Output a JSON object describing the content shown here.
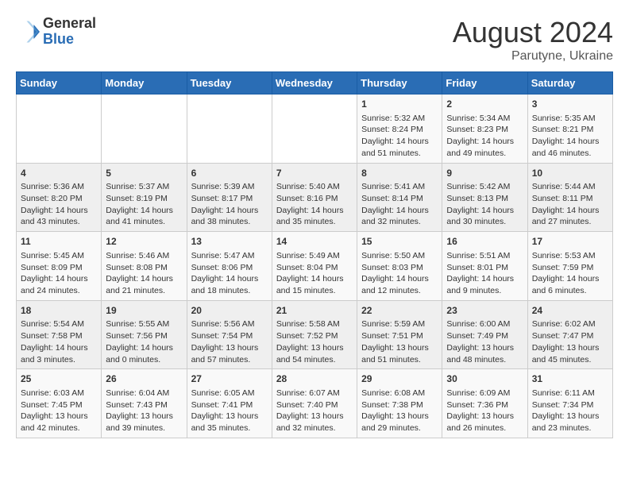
{
  "header": {
    "logo_general": "General",
    "logo_blue": "Blue",
    "month_year": "August 2024",
    "location": "Parutyne, Ukraine"
  },
  "calendar": {
    "days_of_week": [
      "Sunday",
      "Monday",
      "Tuesday",
      "Wednesday",
      "Thursday",
      "Friday",
      "Saturday"
    ],
    "weeks": [
      [
        {
          "day": "",
          "content": ""
        },
        {
          "day": "",
          "content": ""
        },
        {
          "day": "",
          "content": ""
        },
        {
          "day": "",
          "content": ""
        },
        {
          "day": "1",
          "content": "Sunrise: 5:32 AM\nSunset: 8:24 PM\nDaylight: 14 hours and 51 minutes."
        },
        {
          "day": "2",
          "content": "Sunrise: 5:34 AM\nSunset: 8:23 PM\nDaylight: 14 hours and 49 minutes."
        },
        {
          "day": "3",
          "content": "Sunrise: 5:35 AM\nSunset: 8:21 PM\nDaylight: 14 hours and 46 minutes."
        }
      ],
      [
        {
          "day": "4",
          "content": "Sunrise: 5:36 AM\nSunset: 8:20 PM\nDaylight: 14 hours and 43 minutes."
        },
        {
          "day": "5",
          "content": "Sunrise: 5:37 AM\nSunset: 8:19 PM\nDaylight: 14 hours and 41 minutes."
        },
        {
          "day": "6",
          "content": "Sunrise: 5:39 AM\nSunset: 8:17 PM\nDaylight: 14 hours and 38 minutes."
        },
        {
          "day": "7",
          "content": "Sunrise: 5:40 AM\nSunset: 8:16 PM\nDaylight: 14 hours and 35 minutes."
        },
        {
          "day": "8",
          "content": "Sunrise: 5:41 AM\nSunset: 8:14 PM\nDaylight: 14 hours and 32 minutes."
        },
        {
          "day": "9",
          "content": "Sunrise: 5:42 AM\nSunset: 8:13 PM\nDaylight: 14 hours and 30 minutes."
        },
        {
          "day": "10",
          "content": "Sunrise: 5:44 AM\nSunset: 8:11 PM\nDaylight: 14 hours and 27 minutes."
        }
      ],
      [
        {
          "day": "11",
          "content": "Sunrise: 5:45 AM\nSunset: 8:09 PM\nDaylight: 14 hours and 24 minutes."
        },
        {
          "day": "12",
          "content": "Sunrise: 5:46 AM\nSunset: 8:08 PM\nDaylight: 14 hours and 21 minutes."
        },
        {
          "day": "13",
          "content": "Sunrise: 5:47 AM\nSunset: 8:06 PM\nDaylight: 14 hours and 18 minutes."
        },
        {
          "day": "14",
          "content": "Sunrise: 5:49 AM\nSunset: 8:04 PM\nDaylight: 14 hours and 15 minutes."
        },
        {
          "day": "15",
          "content": "Sunrise: 5:50 AM\nSunset: 8:03 PM\nDaylight: 14 hours and 12 minutes."
        },
        {
          "day": "16",
          "content": "Sunrise: 5:51 AM\nSunset: 8:01 PM\nDaylight: 14 hours and 9 minutes."
        },
        {
          "day": "17",
          "content": "Sunrise: 5:53 AM\nSunset: 7:59 PM\nDaylight: 14 hours and 6 minutes."
        }
      ],
      [
        {
          "day": "18",
          "content": "Sunrise: 5:54 AM\nSunset: 7:58 PM\nDaylight: 14 hours and 3 minutes."
        },
        {
          "day": "19",
          "content": "Sunrise: 5:55 AM\nSunset: 7:56 PM\nDaylight: 14 hours and 0 minutes."
        },
        {
          "day": "20",
          "content": "Sunrise: 5:56 AM\nSunset: 7:54 PM\nDaylight: 13 hours and 57 minutes."
        },
        {
          "day": "21",
          "content": "Sunrise: 5:58 AM\nSunset: 7:52 PM\nDaylight: 13 hours and 54 minutes."
        },
        {
          "day": "22",
          "content": "Sunrise: 5:59 AM\nSunset: 7:51 PM\nDaylight: 13 hours and 51 minutes."
        },
        {
          "day": "23",
          "content": "Sunrise: 6:00 AM\nSunset: 7:49 PM\nDaylight: 13 hours and 48 minutes."
        },
        {
          "day": "24",
          "content": "Sunrise: 6:02 AM\nSunset: 7:47 PM\nDaylight: 13 hours and 45 minutes."
        }
      ],
      [
        {
          "day": "25",
          "content": "Sunrise: 6:03 AM\nSunset: 7:45 PM\nDaylight: 13 hours and 42 minutes."
        },
        {
          "day": "26",
          "content": "Sunrise: 6:04 AM\nSunset: 7:43 PM\nDaylight: 13 hours and 39 minutes."
        },
        {
          "day": "27",
          "content": "Sunrise: 6:05 AM\nSunset: 7:41 PM\nDaylight: 13 hours and 35 minutes."
        },
        {
          "day": "28",
          "content": "Sunrise: 6:07 AM\nSunset: 7:40 PM\nDaylight: 13 hours and 32 minutes."
        },
        {
          "day": "29",
          "content": "Sunrise: 6:08 AM\nSunset: 7:38 PM\nDaylight: 13 hours and 29 minutes."
        },
        {
          "day": "30",
          "content": "Sunrise: 6:09 AM\nSunset: 7:36 PM\nDaylight: 13 hours and 26 minutes."
        },
        {
          "day": "31",
          "content": "Sunrise: 6:11 AM\nSunset: 7:34 PM\nDaylight: 13 hours and 23 minutes."
        }
      ]
    ]
  }
}
